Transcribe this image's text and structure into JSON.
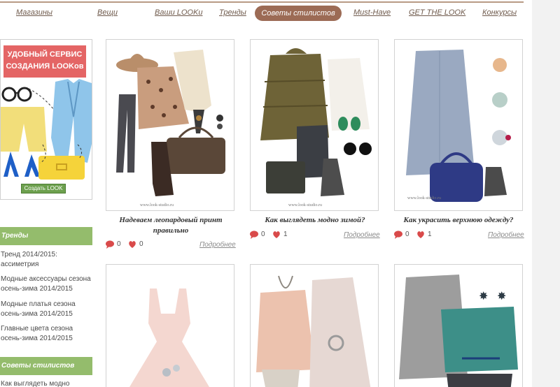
{
  "nav": {
    "items": [
      "Магазины",
      "Вещи",
      "Ваши LOOKи",
      "Тренды",
      "Must-Have",
      "GET THE LOOK",
      "Конкурсы"
    ],
    "active": "Советы стилистов",
    "accent": "#9c6b55"
  },
  "banner": {
    "title_line1": "УДОБНЫЙ СЕРВИС",
    "title_line2": "СОЗДАНИЯ LOOKов",
    "button": "Создать LOOK",
    "title_color": "#e46565",
    "button_color": "#6da04e"
  },
  "sidebar": {
    "section_color": "#94bc6c",
    "trends": {
      "heading": "Тренды",
      "links": [
        "Тренд 2014/2015: ассиметрия",
        "Модные аксессуары сезона осень-зима 2014/2015",
        "Модные платья сезона осень-зима 2014/2015",
        "Главные цвета сезона осень-зима 2014/2015"
      ]
    },
    "tips": {
      "heading": "Советы стилистов",
      "links": [
        "Как выглядеть модно"
      ]
    }
  },
  "cards": [
    {
      "title": "Надеваем леопардовый принт правильно",
      "comments": "0",
      "likes": "0",
      "more": "Подробнее",
      "watermark": "www.look-studio.ru"
    },
    {
      "title": "Как выглядеть модно зимой?",
      "comments": "0",
      "likes": "1",
      "more": "Подробнее",
      "watermark": "www.look-studio.ru"
    },
    {
      "title": "Как украсить верхнюю одежду?",
      "comments": "0",
      "likes": "1",
      "more": "Подробнее",
      "watermark": "www.look-studio.ru"
    },
    {
      "title": ""
    },
    {
      "title": ""
    },
    {
      "title": ""
    }
  ],
  "icons": {
    "comment": "comment-bubble-icon",
    "like": "heart-icon",
    "icon_color": "#d94a4a"
  }
}
